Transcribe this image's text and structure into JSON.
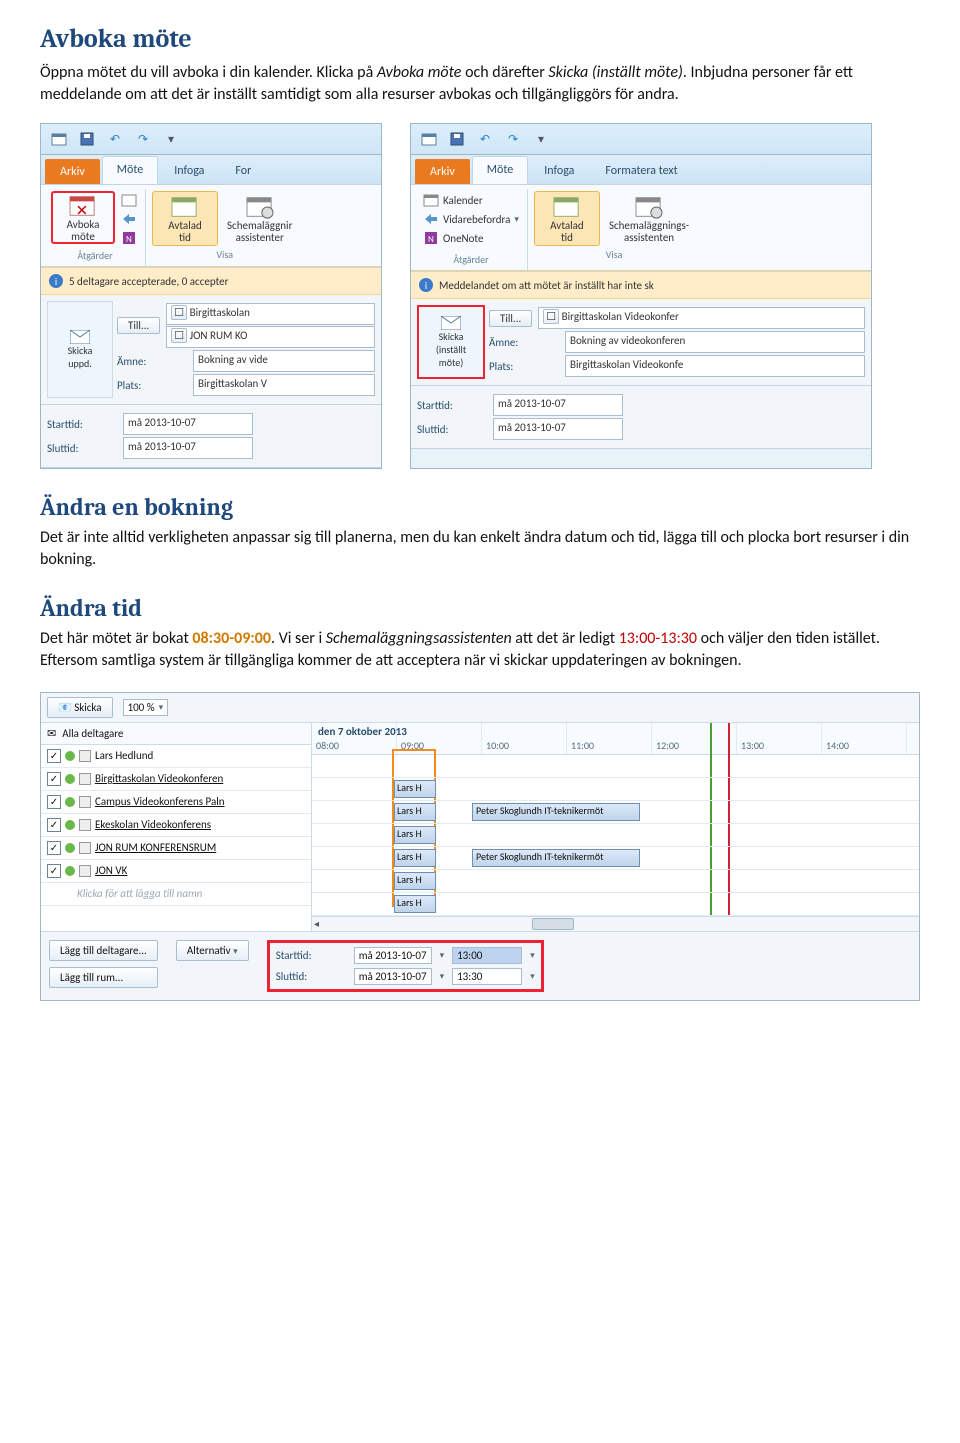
{
  "headings": {
    "h1": "Avboka möte",
    "h2a": "Ändra en bokning",
    "h2b": "Ändra tid"
  },
  "paras": {
    "p1a": "Öppna mötet du vill avboka i din kalender. Klicka på ",
    "p1i1": "Avboka möte",
    "p1b": " och därefter ",
    "p1i2": "Skicka (inställt möte)",
    "p1c": ". Inbjudna personer får ett meddelande om att det är inställt samtidigt som alla resurser avbokas och tillgängliggörs för andra.",
    "p2": "Det är inte alltid verkligheten anpassar sig till planerna, men du kan enkelt ändra datum och tid, lägga till och plocka bort resurser i din bokning.",
    "p3a": "Det här mötet är bokat ",
    "p3t1": "08:30-09:00",
    "p3b": ". Vi ser i ",
    "p3i": "Schemaläggningsassistenten",
    "p3c": " att det är ledigt ",
    "p3t2": "13:00-13:30",
    "p3d": " och väljer den tiden istället. Eftersom samtliga system är tillgängliga kommer de att acceptera när vi skickar uppdateringen av bokningen."
  },
  "w1": {
    "tabs": {
      "file": "Arkiv",
      "meeting": "Möte",
      "insert": "Infoga",
      "format": "For"
    },
    "ribbon": {
      "cancel": "Avboka\nmöte",
      "avtalad": "Avtalad\ntid",
      "sched": "Schemaläggnir\nassistenter",
      "g1": "Åtgärder",
      "g2": "Visa"
    },
    "info": "5 deltagare accepterade, 0 accepter",
    "send": "Skicka\nuppd.",
    "till": "Till...",
    "amne": "Ämne:",
    "plats": "Plats:",
    "till_val": "Birgittaskolan",
    "till_val2": "JON RUM KO",
    "amne_val": "Bokning av vide",
    "plats_val": "Birgittaskolan V",
    "start": "Starttid:",
    "slut": "Sluttid:",
    "start_val": "må 2013-10-07",
    "slut_val": "må 2013-10-07"
  },
  "w2": {
    "tabs": {
      "file": "Arkiv",
      "meeting": "Möte",
      "insert": "Infoga",
      "format": "Formatera text"
    },
    "ribbon": {
      "kal": "Kalender",
      "vidare": "Vidarebefordra",
      "onenote": "OneNote",
      "avtalad": "Avtalad\ntid",
      "sched": "Schemaläggnings-\nassistenten",
      "g1": "Åtgärder",
      "g2": "Visa"
    },
    "info": "Meddelandet om att mötet är inställt har inte sk",
    "send": "Skicka\n(inställt\nmöte)",
    "till": "Till...",
    "amne": "Ämne:",
    "plats": "Plats:",
    "till_val": "Birgittaskolan Videokonfer",
    "amne_val": "Bokning av videokonferen",
    "plats_val": "Birgittaskolan Videokonfe",
    "start": "Starttid:",
    "slut": "Sluttid:",
    "start_val": "må 2013-10-07",
    "slut_val": "må 2013-10-07"
  },
  "sched": {
    "send": "Skicka",
    "zoom": "100 %",
    "date": "den 7 oktober 2013",
    "hours": [
      "08:00",
      "09:00",
      "10:00",
      "11:00",
      "12:00",
      "13:00",
      "14:00"
    ],
    "all": "Alla deltagare",
    "attendees": [
      "Lars Hedlund",
      "Birgittaskolan Videokonferen",
      "Campus Videokonferens Paln",
      "Ekeskolan Videokonferens",
      "JON  RUM  KONFERENSRUM",
      "JON  VK"
    ],
    "placeholder": "Klicka för att lägga till namn",
    "lars": "Lars H",
    "busy": "Peter Skoglundh IT-teknikermöt",
    "add_att": "Lägg till deltagare...",
    "alt": "Alternativ",
    "add_room": "Lägg till rum...",
    "start": "Starttid:",
    "slut": "Sluttid:",
    "start_d": "må 2013-10-07",
    "start_t": "13:00",
    "slut_d": "må 2013-10-07",
    "slut_t": "13:30"
  }
}
